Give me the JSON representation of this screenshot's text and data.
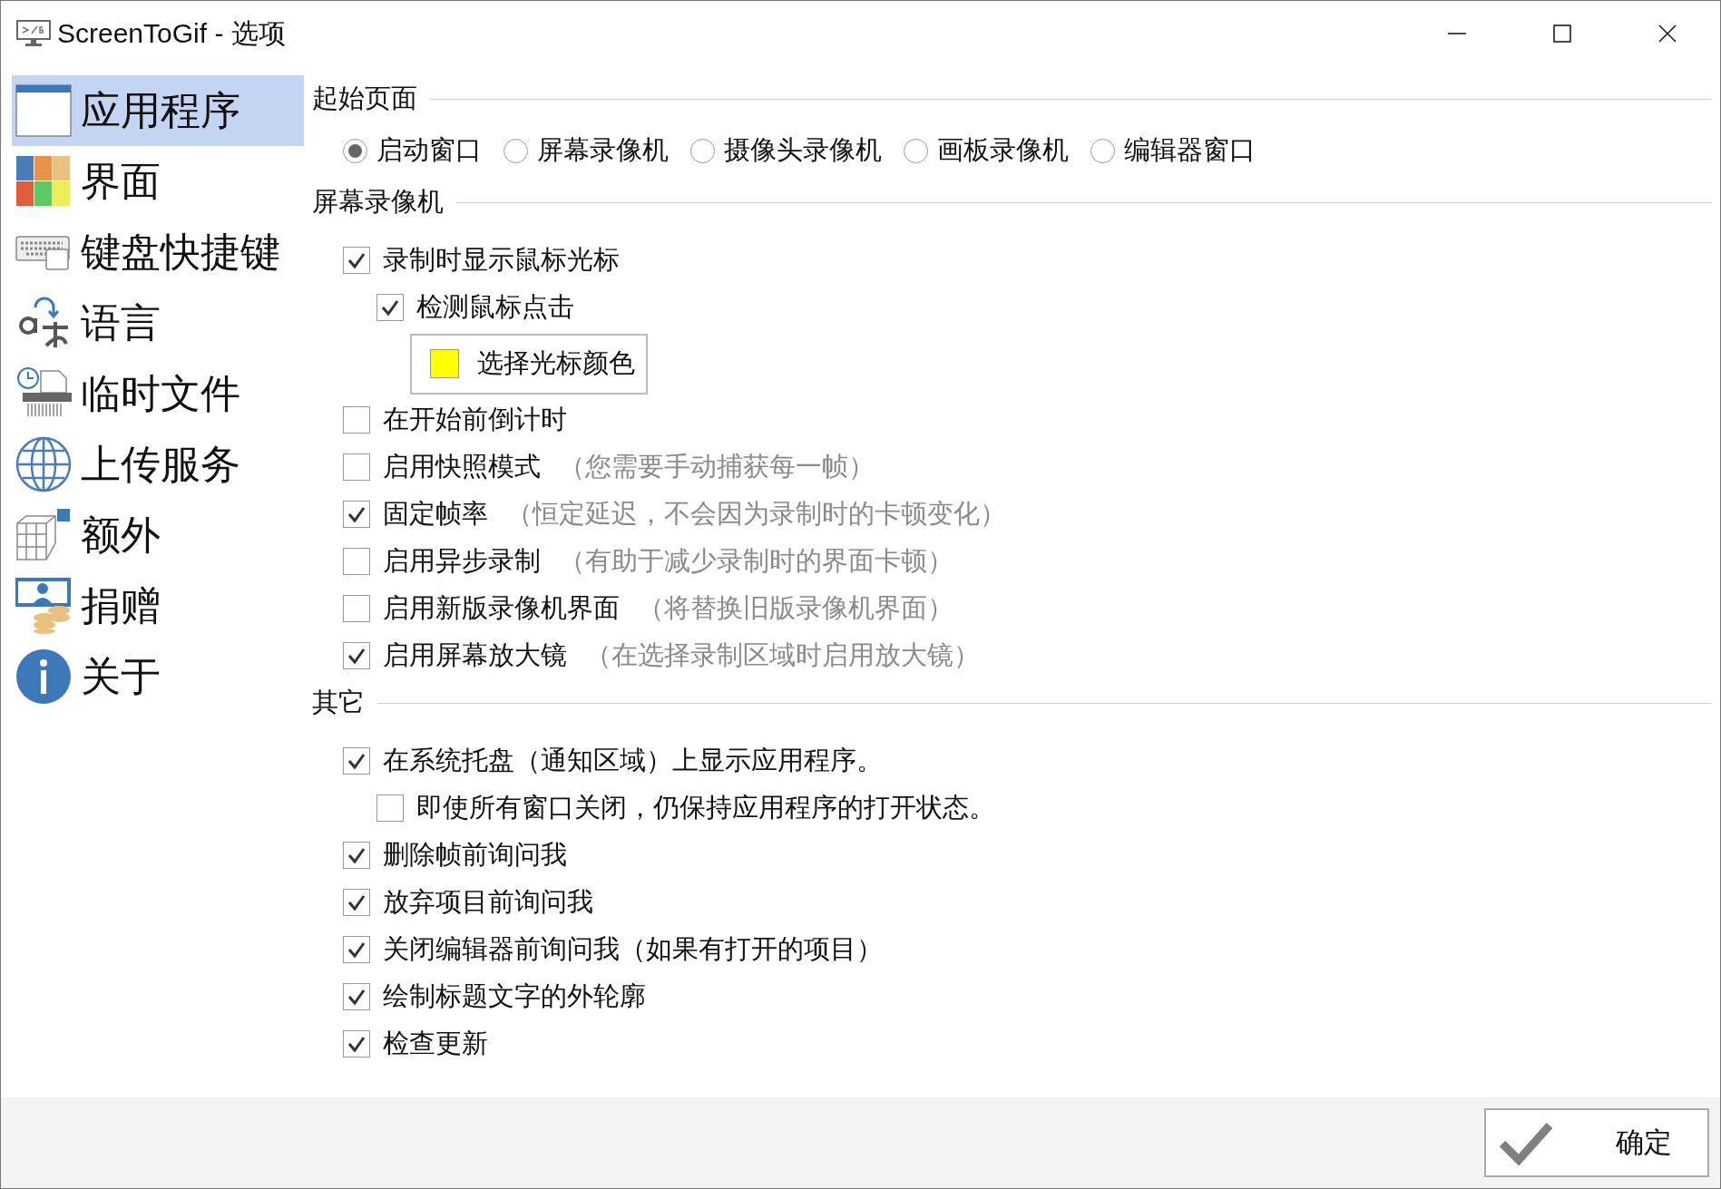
{
  "window": {
    "title": "ScreenToGif - 选项"
  },
  "sidebar": {
    "items": [
      {
        "label": "应用程序",
        "selected": true
      },
      {
        "label": "界面",
        "selected": false
      },
      {
        "label": "键盘快捷键",
        "selected": false
      },
      {
        "label": "语言",
        "selected": false
      },
      {
        "label": "临时文件",
        "selected": false
      },
      {
        "label": "上传服务",
        "selected": false
      },
      {
        "label": "额外",
        "selected": false
      },
      {
        "label": "捐赠",
        "selected": false
      },
      {
        "label": "关于",
        "selected": false
      }
    ]
  },
  "sections": [
    {
      "title": "起始页面",
      "kind": "radios",
      "options": [
        {
          "label": "启动窗口",
          "selected": true
        },
        {
          "label": "屏幕录像机",
          "selected": false
        },
        {
          "label": "摄像头录像机",
          "selected": false
        },
        {
          "label": "画板录像机",
          "selected": false
        },
        {
          "label": "编辑器窗口",
          "selected": false
        }
      ]
    },
    {
      "title": "屏幕录像机",
      "kind": "checks",
      "items": [
        {
          "kind": "checkbox",
          "label": "录制时显示鼠标光标",
          "checked": true,
          "children": [
            {
              "kind": "checkbox",
              "label": "检测鼠标点击",
              "checked": true,
              "children": [
                {
                  "kind": "color-button",
                  "label": "选择光标颜色",
                  "color": "#ffff00"
                }
              ]
            }
          ]
        },
        {
          "kind": "checkbox",
          "label": "在开始前倒计时",
          "checked": false
        },
        {
          "kind": "checkbox",
          "label": "启用快照模式",
          "checked": false,
          "note": "（您需要手动捕获每一帧）"
        },
        {
          "kind": "checkbox",
          "label": "固定帧率",
          "checked": true,
          "note": "（恒定延迟，不会因为录制时的卡顿变化）"
        },
        {
          "kind": "checkbox",
          "label": "启用异步录制",
          "checked": false,
          "note": "（有助于减少录制时的界面卡顿）"
        },
        {
          "kind": "checkbox",
          "label": "启用新版录像机界面",
          "checked": false,
          "note": "（将替换旧版录像机界面）"
        },
        {
          "kind": "checkbox",
          "label": "启用屏幕放大镜",
          "checked": true,
          "note": "（在选择录制区域时启用放大镜）"
        }
      ]
    },
    {
      "title": "其它",
      "kind": "checks",
      "items": [
        {
          "kind": "checkbox",
          "label": "在系统托盘（通知区域）上显示应用程序。",
          "checked": true,
          "children": [
            {
              "kind": "checkbox",
              "label": "即使所有窗口关闭，仍保持应用程序的打开状态。",
              "checked": false
            }
          ]
        },
        {
          "kind": "checkbox",
          "label": "删除帧前询问我",
          "checked": true
        },
        {
          "kind": "checkbox",
          "label": "放弃项目前询问我",
          "checked": true
        },
        {
          "kind": "checkbox",
          "label": "关闭编辑器前询问我（如果有打开的项目）",
          "checked": true
        },
        {
          "kind": "checkbox",
          "label": "绘制标题文字的外轮廓",
          "checked": true
        },
        {
          "kind": "checkbox",
          "label": "检查更新",
          "checked": true
        }
      ]
    }
  ],
  "footer": {
    "ok_button": "确定"
  }
}
